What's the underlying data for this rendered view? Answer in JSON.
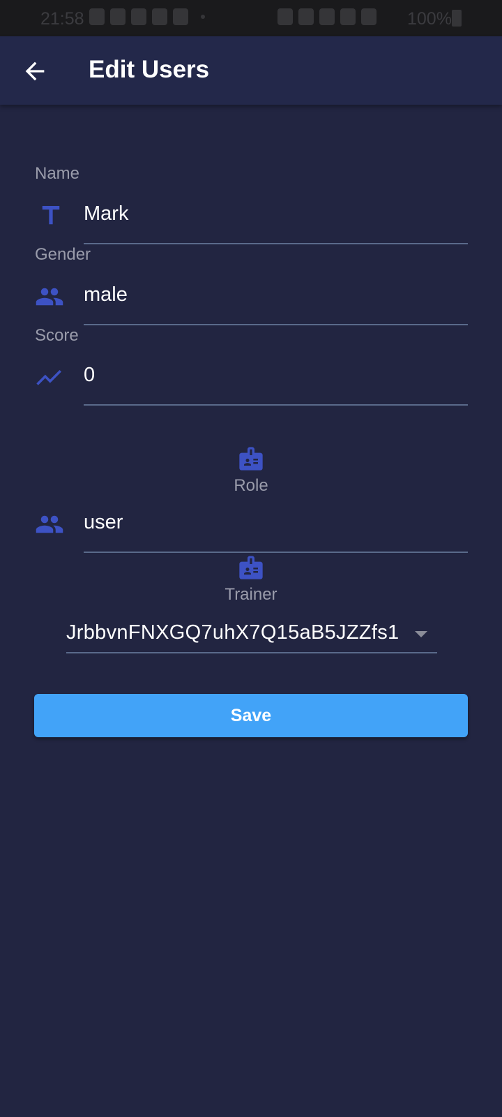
{
  "status_bar": {
    "time": "21:58",
    "battery": "100%",
    "network": "VoLTE1"
  },
  "app_bar": {
    "title": "Edit Users",
    "back_icon": "arrow-back-icon"
  },
  "form": {
    "name": {
      "label": "Name",
      "value": "Mark",
      "icon": "text-icon"
    },
    "gender": {
      "label": "Gender",
      "value": "male",
      "icon": "people-icon"
    },
    "score": {
      "label": "Score",
      "value": "0",
      "icon": "trending-up-icon"
    },
    "role": {
      "label": "Role",
      "value": "user",
      "header_icon": "badge-icon",
      "icon": "people-icon"
    },
    "trainer": {
      "label": "Trainer",
      "value": "JrbbvnFNXGQ7uhX7Q15aB5JZZfs1",
      "header_icon": "badge-icon"
    },
    "save_label": "Save"
  },
  "colors": {
    "background": "#222541",
    "app_bar": "#23284a",
    "icon_accent": "#3d52c4",
    "button": "#42a3f8",
    "underline": "#5a6a8a"
  }
}
